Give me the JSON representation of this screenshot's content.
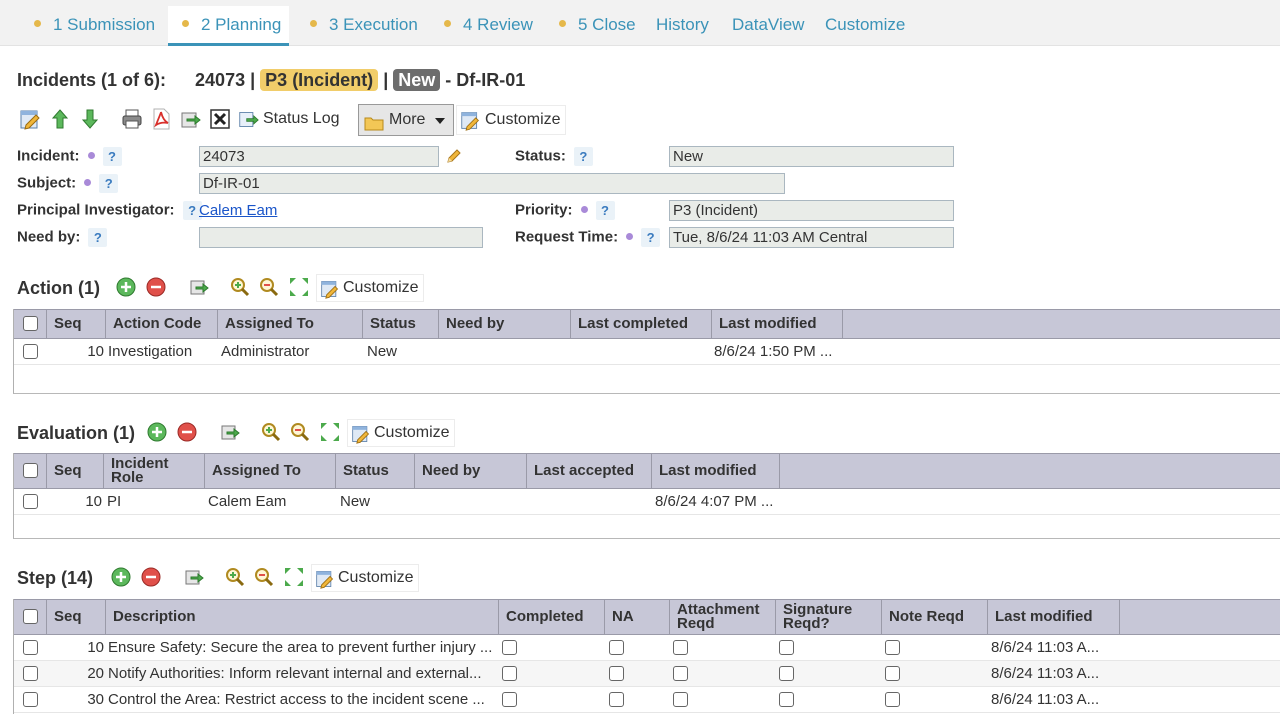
{
  "tabs": [
    {
      "label": "1 Submission",
      "dot": true
    },
    {
      "label": "2 Planning",
      "dot": true,
      "active": true
    },
    {
      "label": "3 Execution",
      "dot": true
    },
    {
      "label": "4 Review",
      "dot": true
    },
    {
      "label": "5 Close",
      "dot": true
    },
    {
      "label": "History",
      "dot": false
    },
    {
      "label": "DataView",
      "dot": false
    },
    {
      "label": "Customize",
      "dot": false
    }
  ],
  "header": {
    "title": "Incidents (1 of 6):",
    "id": "24073",
    "sep1": "|",
    "priority": "P3 (Incident)",
    "sep2": "|",
    "status": "New",
    "suffix": "- Df-IR-01"
  },
  "toolbar": {
    "status_log": "Status Log",
    "more": "More",
    "customize": "Customize"
  },
  "form": {
    "incident_label": "Incident:",
    "incident_value": "24073",
    "subject_label": "Subject:",
    "subject_value": "Df-IR-01",
    "pi_label": "Principal Investigator:",
    "pi_value": "Calem Eam",
    "needby_label": "Need by:",
    "needby_value": "",
    "status_label": "Status:",
    "status_value": "New",
    "priority_label": "Priority:",
    "priority_value": "P3 (Incident)",
    "request_time_label": "Request Time:",
    "request_time_value": "Tue, 8/6/24 11:03 AM Central",
    "help": "?"
  },
  "action": {
    "title": "Action (1)",
    "customize": "Customize",
    "headers": [
      "Seq",
      "Action Code",
      "Assigned To",
      "Status",
      "Need by",
      "Last completed",
      "Last modified"
    ],
    "rows": [
      {
        "seq": "10",
        "code": "Investigation",
        "assigned": "Administrator",
        "status": "New",
        "needby": "",
        "completed": "",
        "modified": "8/6/24 1:50 PM ..."
      }
    ]
  },
  "evaluation": {
    "title": "Evaluation (1)",
    "customize": "Customize",
    "headers": [
      "Seq",
      "Incident Role",
      "Assigned To",
      "Status",
      "Need by",
      "Last accepted",
      "Last modified"
    ],
    "rows": [
      {
        "seq": "10",
        "role": "PI",
        "assigned": "Calem Eam",
        "status": "New",
        "needby": "",
        "accepted": "",
        "modified": "8/6/24 4:07 PM ..."
      }
    ]
  },
  "step": {
    "title": "Step (14)",
    "customize": "Customize",
    "headers": [
      "Seq",
      "Description",
      "Completed",
      "NA",
      "Attachment Reqd",
      "Signature Reqd?",
      "Note Reqd",
      "Last modified"
    ],
    "rows": [
      {
        "seq": "10",
        "description": "Ensure Safety: Secure the area to prevent further injury ...",
        "modified": "8/6/24 11:03 A..."
      },
      {
        "seq": "20",
        "description": "Notify Authorities: Inform relevant internal and external...",
        "modified": "8/6/24 11:03 A..."
      },
      {
        "seq": "30",
        "description": "Control the Area: Restrict access to the incident scene ...",
        "modified": "8/6/24 11:03 A..."
      }
    ]
  }
}
